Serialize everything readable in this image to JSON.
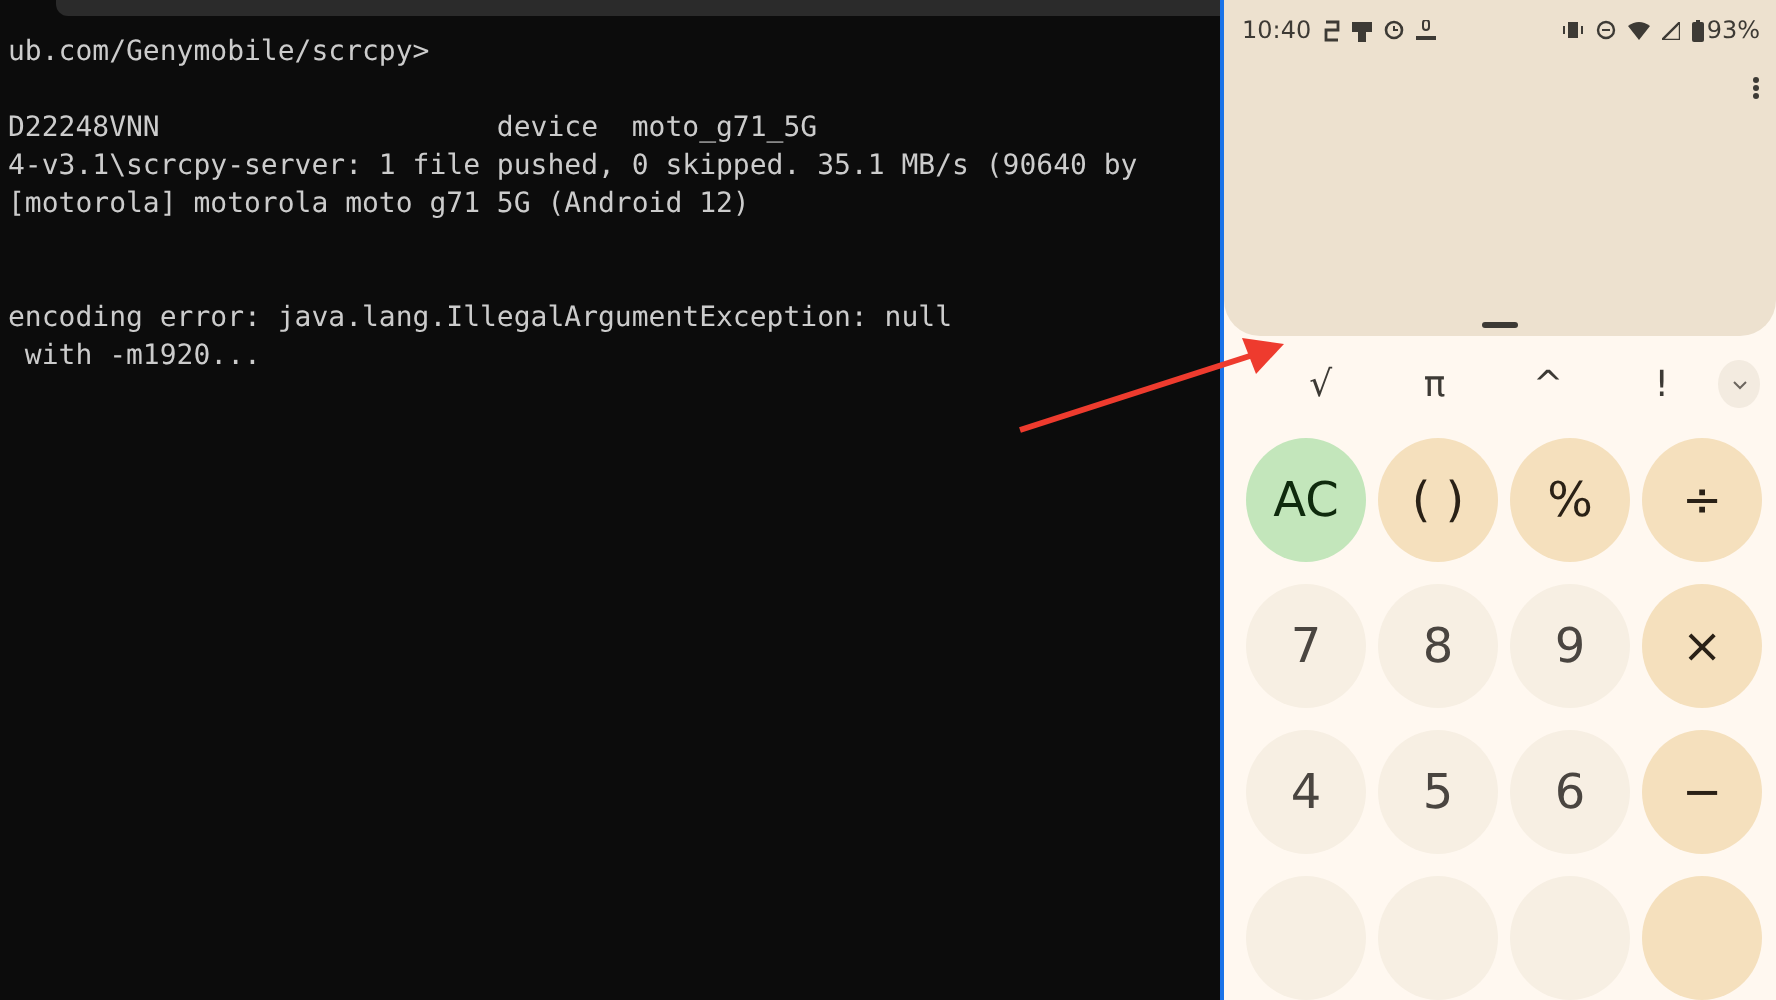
{
  "terminal": {
    "lines": [
      {
        "kind": "text",
        "text": "ub.com/Genymobile/scrcpy>"
      },
      {
        "kind": "blank"
      },
      {
        "kind": "text",
        "text": "D22248VNN                    device  moto_g71_5G"
      },
      {
        "kind": "text",
        "text": "4-v3.1\\scrcpy-server: 1 file pushed, 0 skipped. 35.1 MB/s (90640 by"
      },
      {
        "kind": "text",
        "text": "[motorola] motorola moto g71 5G (Android 12)"
      },
      {
        "kind": "blank"
      },
      {
        "kind": "blank"
      },
      {
        "kind": "text",
        "text": "encoding error: java.lang.IllegalArgumentException: null"
      },
      {
        "kind": "text",
        "text": " with -m1920..."
      }
    ]
  },
  "phone": {
    "status_bar": {
      "time": "10:40",
      "battery": "93%"
    },
    "scientific_keys": [
      "√",
      "π",
      "^",
      "!"
    ],
    "keys": [
      {
        "kind": "clear",
        "label": "AC"
      },
      {
        "kind": "operator",
        "label": "( )"
      },
      {
        "kind": "operator",
        "label": "%"
      },
      {
        "kind": "operator",
        "label": "÷"
      },
      {
        "kind": "digit",
        "label": "7"
      },
      {
        "kind": "digit",
        "label": "8"
      },
      {
        "kind": "digit",
        "label": "9"
      },
      {
        "kind": "operator",
        "label": "×"
      },
      {
        "kind": "digit",
        "label": "4"
      },
      {
        "kind": "digit",
        "label": "5"
      },
      {
        "kind": "digit",
        "label": "6"
      },
      {
        "kind": "operator",
        "label": "−"
      },
      {
        "kind": "digit"
      },
      {
        "kind": "digit"
      },
      {
        "kind": "digit"
      },
      {
        "kind": "operator"
      }
    ]
  }
}
